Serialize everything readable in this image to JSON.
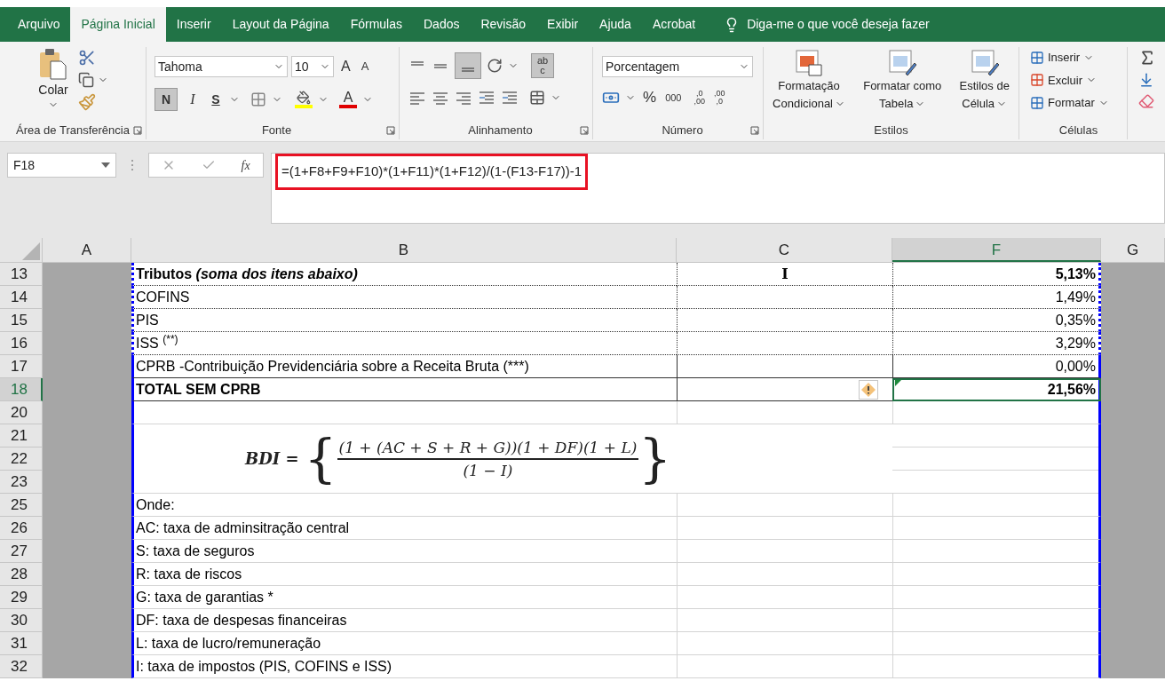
{
  "ribbon_tabs": [
    {
      "label": "Arquivo",
      "selected": false
    },
    {
      "label": "Página Inicial",
      "selected": true
    },
    {
      "label": "Inserir",
      "selected": false
    },
    {
      "label": "Layout da Página",
      "selected": false
    },
    {
      "label": "Fórmulas",
      "selected": false
    },
    {
      "label": "Dados",
      "selected": false
    },
    {
      "label": "Revisão",
      "selected": false
    },
    {
      "label": "Exibir",
      "selected": false
    },
    {
      "label": "Ajuda",
      "selected": false
    },
    {
      "label": "Acrobat",
      "selected": false
    }
  ],
  "tell_me": "Diga-me o que você deseja fazer",
  "clipboard": {
    "paste": "Colar",
    "label": "Área de Transferência"
  },
  "font": {
    "name": "Tahoma",
    "size": "10",
    "grow": "A",
    "shrink": "A",
    "bold": "N",
    "italic": "I",
    "underline": "S",
    "color_glyph": "A",
    "label": "Fonte"
  },
  "alignment": {
    "wrap_glyph": [
      "ab",
      "c"
    ],
    "label": "Alinhamento"
  },
  "number": {
    "format": "Porcentagem",
    "percent": "%",
    "thousands": "000",
    "increase_decimal": [
      ",0",
      ",00"
    ],
    "decrease_decimal": [
      ",00",
      ",0"
    ],
    "label": "Número"
  },
  "styles": {
    "buttons": [
      {
        "lines": [
          "Formatação",
          "Condicional"
        ]
      },
      {
        "lines": [
          "Formatar como",
          "Tabela"
        ]
      },
      {
        "lines": [
          "Estilos de",
          "Célula"
        ]
      }
    ],
    "label": "Estilos"
  },
  "cells": {
    "buttons": [
      "Inserir",
      "Excluir",
      "Formatar"
    ],
    "label": "Células"
  },
  "formula_bar": {
    "name_box": "F18",
    "fx": "fx",
    "formula": "=(1+F8+F9+F10)*(1+F11)*(1+F12)/(1-(F13-F17))-1",
    "highlighted": true
  },
  "columns": [
    {
      "label": "A",
      "selected": false
    },
    {
      "label": "B",
      "selected": false
    },
    {
      "label": "C",
      "selected": false
    },
    {
      "label": "F",
      "selected": true
    },
    {
      "label": "G",
      "selected": false
    }
  ],
  "rows": [
    {
      "number": "13",
      "kind": "tax_header",
      "selected": false,
      "warning": false,
      "b": "Tributos *(soma dos itens abaixo)*",
      "c": "I",
      "f": "5,13%"
    },
    {
      "number": "14",
      "kind": "tax",
      "selected": false,
      "warning": false,
      "b": "COFINS",
      "f": "1,49%"
    },
    {
      "number": "15",
      "kind": "tax",
      "selected": false,
      "warning": false,
      "b": "PIS",
      "f": "0,35%"
    },
    {
      "number": "16",
      "kind": "tax",
      "selected": false,
      "warning": false,
      "b": "ISS $^{(**)}$",
      "f": "3,29%"
    },
    {
      "number": "17",
      "kind": "tax_last",
      "selected": false,
      "warning": false,
      "b": "CPRB -Contribuição Previdenciária sobre a Receita Bruta (***)",
      "f": "0,00%"
    },
    {
      "number": "18",
      "kind": "total",
      "selected": true,
      "warning": true,
      "b": "TOTAL SEM CPRB",
      "f": "21,56%"
    },
    {
      "number": "20",
      "kind": "blank",
      "selected": false,
      "warning": false
    },
    {
      "numbers": [
        "21",
        "22",
        "23"
      ],
      "kind": "formula",
      "selected": false,
      "lhs": "BDI =",
      "open": "{",
      "numerator": "(1 + (AC + S + R + G))(1 + DF)(1 + L)",
      "denominator": "(1 − I)",
      "close": "}"
    },
    {
      "number": "25",
      "kind": "note",
      "selected": false,
      "warning": false,
      "b": "Onde:"
    },
    {
      "number": "26",
      "kind": "note",
      "selected": false,
      "warning": false,
      "b": "AC: taxa de adminsitração central"
    },
    {
      "number": "27",
      "kind": "note",
      "selected": false,
      "warning": false,
      "b": "S: taxa de seguros"
    },
    {
      "number": "28",
      "kind": "note",
      "selected": false,
      "warning": false,
      "b": "R: taxa de riscos"
    },
    {
      "number": "29",
      "kind": "note",
      "selected": false,
      "warning": false,
      "b": "G: taxa de garantias *"
    },
    {
      "number": "30",
      "kind": "note",
      "selected": false,
      "warning": false,
      "b": "DF: taxa de despesas financeiras"
    },
    {
      "number": "31",
      "kind": "note",
      "selected": false,
      "warning": false,
      "b": "L: taxa de lucro/remuneração"
    },
    {
      "number": "32",
      "kind": "note",
      "selected": false,
      "warning": false,
      "b": "I: taxa de impostos (PIS, COFINS e ISS)"
    }
  ]
}
